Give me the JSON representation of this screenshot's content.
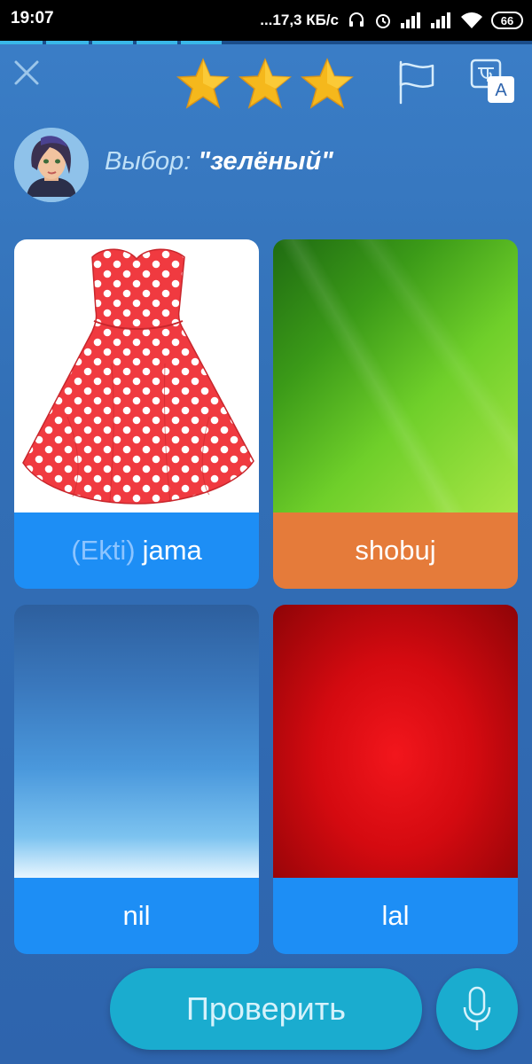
{
  "status_bar": {
    "time": "19:07",
    "network_speed": "...17,3 КБ/с",
    "battery": "66"
  },
  "lesson": {
    "progress_segments": 5,
    "progress_filled": 5,
    "stars": 3
  },
  "prompt": {
    "prefix": "Выбор: ",
    "word": "\"зелёный\""
  },
  "cards": [
    {
      "article": "(Ekti)",
      "word": "jama",
      "image": "red-polka-dot-dress",
      "selected": false
    },
    {
      "article": "",
      "word": "shobuj",
      "image": "green-leaf",
      "selected": true
    },
    {
      "article": "",
      "word": "nil",
      "image": "blue-sky",
      "selected": false
    },
    {
      "article": "",
      "word": "lal",
      "image": "red-background",
      "selected": false
    }
  ],
  "actions": {
    "check_label": "Проверить"
  },
  "colors": {
    "background": "#326fb6",
    "label_default": "#1d8ef5",
    "label_selected": "#e57b3a",
    "button": "#1aaccf",
    "star": "#f5b81c"
  }
}
